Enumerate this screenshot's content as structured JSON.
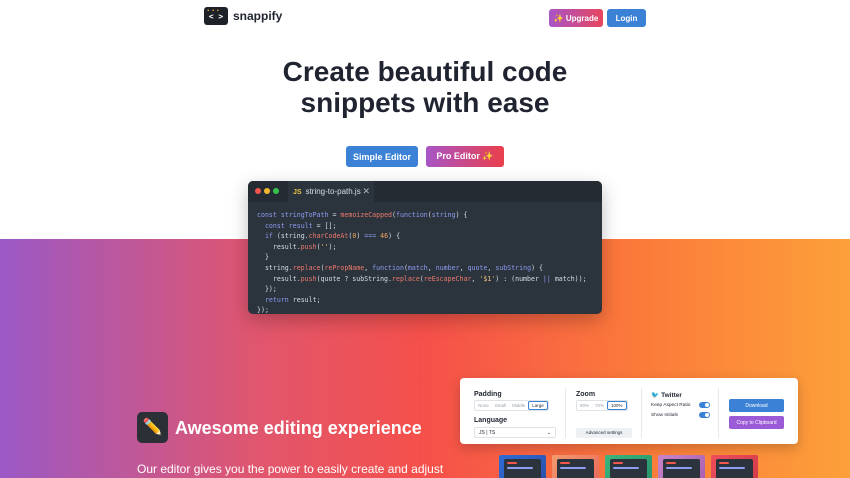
{
  "header": {
    "logo_glyph": "< >",
    "brand": "snappify",
    "upgrade_label": "✨ Upgrade",
    "login_label": "Login"
  },
  "hero": {
    "title_line1": "Create beautiful code",
    "title_line2": "snippets with ease",
    "simple_editor_label": "Simple Editor",
    "pro_editor_label": "Pro Editor ✨"
  },
  "editor": {
    "tab_lang": "JS",
    "tab_filename": "string-to-path.js",
    "tab_close": "✕"
  },
  "feature": {
    "icon": "pencil-icon",
    "title": "Awesome editing experience",
    "description": "Our editor gives you the power to easily create and adjust"
  },
  "settings": {
    "padding_label": "Padding",
    "padding_options": [
      "None",
      "Small",
      "Middle",
      "Large"
    ],
    "padding_selected": "Large",
    "language_label": "Language",
    "language_value": "JS | TS",
    "zoom_label": "Zoom",
    "zoom_options": [
      "50%",
      "70%",
      "100%"
    ],
    "zoom_selected": "100%",
    "advanced_label": "Advanced settings",
    "twitter_label": "Twitter",
    "keep_aspect_label": "Keep Aspect Ratio",
    "show_initials_label": "Show Initials",
    "keep_aspect_on": true,
    "show_initials_on": true,
    "download_label": "Download",
    "copy_label": "Copy to Clipboard"
  },
  "colors": {
    "primary": "#3b82d6",
    "accent_purple": "#9b59c6",
    "accent_orange": "#fca03a",
    "editor_bg": "#2b333d"
  }
}
